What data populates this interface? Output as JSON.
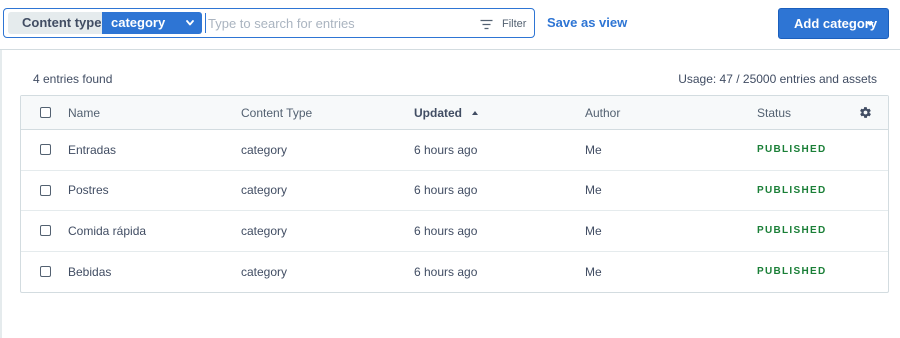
{
  "toolbar": {
    "content_type_label": "Content type",
    "content_type_value": "category",
    "search_placeholder": "Type to search for entries",
    "filter_label": "Filter",
    "save_view_label": "Save as view",
    "add_button_label": "Add category"
  },
  "summary": {
    "entries_found": "4 entries found",
    "usage": "Usage: 47 / 25000 entries and assets"
  },
  "table": {
    "columns": {
      "name": "Name",
      "content_type": "Content Type",
      "updated": "Updated",
      "author": "Author",
      "status": "Status"
    },
    "rows": [
      {
        "name": "Entradas",
        "content_type": "category",
        "updated": "6 hours ago",
        "author": "Me",
        "status": "PUBLISHED"
      },
      {
        "name": "Postres",
        "content_type": "category",
        "updated": "6 hours ago",
        "author": "Me",
        "status": "PUBLISHED"
      },
      {
        "name": "Comida rápida",
        "content_type": "category",
        "updated": "6 hours ago",
        "author": "Me",
        "status": "PUBLISHED"
      },
      {
        "name": "Bebidas",
        "content_type": "category",
        "updated": "6 hours ago",
        "author": "Me",
        "status": "PUBLISHED"
      }
    ]
  },
  "colors": {
    "primary": "#2e75d4",
    "published": "#1a7f37",
    "text": "#414d63"
  },
  "icons": [
    "chevron-down-icon",
    "filter-icon",
    "caret-down-icon",
    "sort-ascending-icon",
    "gear-icon"
  ]
}
